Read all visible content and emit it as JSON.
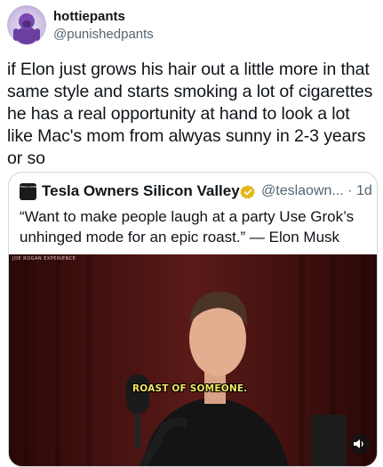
{
  "tweet": {
    "username": "hottiepants",
    "handle": "@punishedpants",
    "text": "if Elon just grows his hair out a little more in that same style and starts smoking a lot of cigarettes he has a real opportunity at hand to look a lot like Mac's mom from alwyas sunny in 2-3 years or so"
  },
  "quoted_tweet": {
    "account_name": "Tesla Owners Silicon Valley",
    "handle_time": "@teslaown... · 1d",
    "logo_text": "TESLA OWNERS SILICON VALLEY",
    "text": "“Want to make people laugh at a party Use Grok’s unhinged mode for an epic roast.” — Elon Musk",
    "video": {
      "watermark": "JOE ROGAN EXPERIENCE",
      "caption": "ROAST OF SOMEONE."
    }
  },
  "icons": {
    "avatar": "purple-gorilla-avatar",
    "verified": "verified-badge-icon",
    "sound": "speaker-icon"
  },
  "colors": {
    "text_primary": "#0f1419",
    "text_secondary": "#536471",
    "border": "#cfd9de",
    "verified_gold": "#e2b719",
    "caption_yellow": "#f5e663"
  }
}
